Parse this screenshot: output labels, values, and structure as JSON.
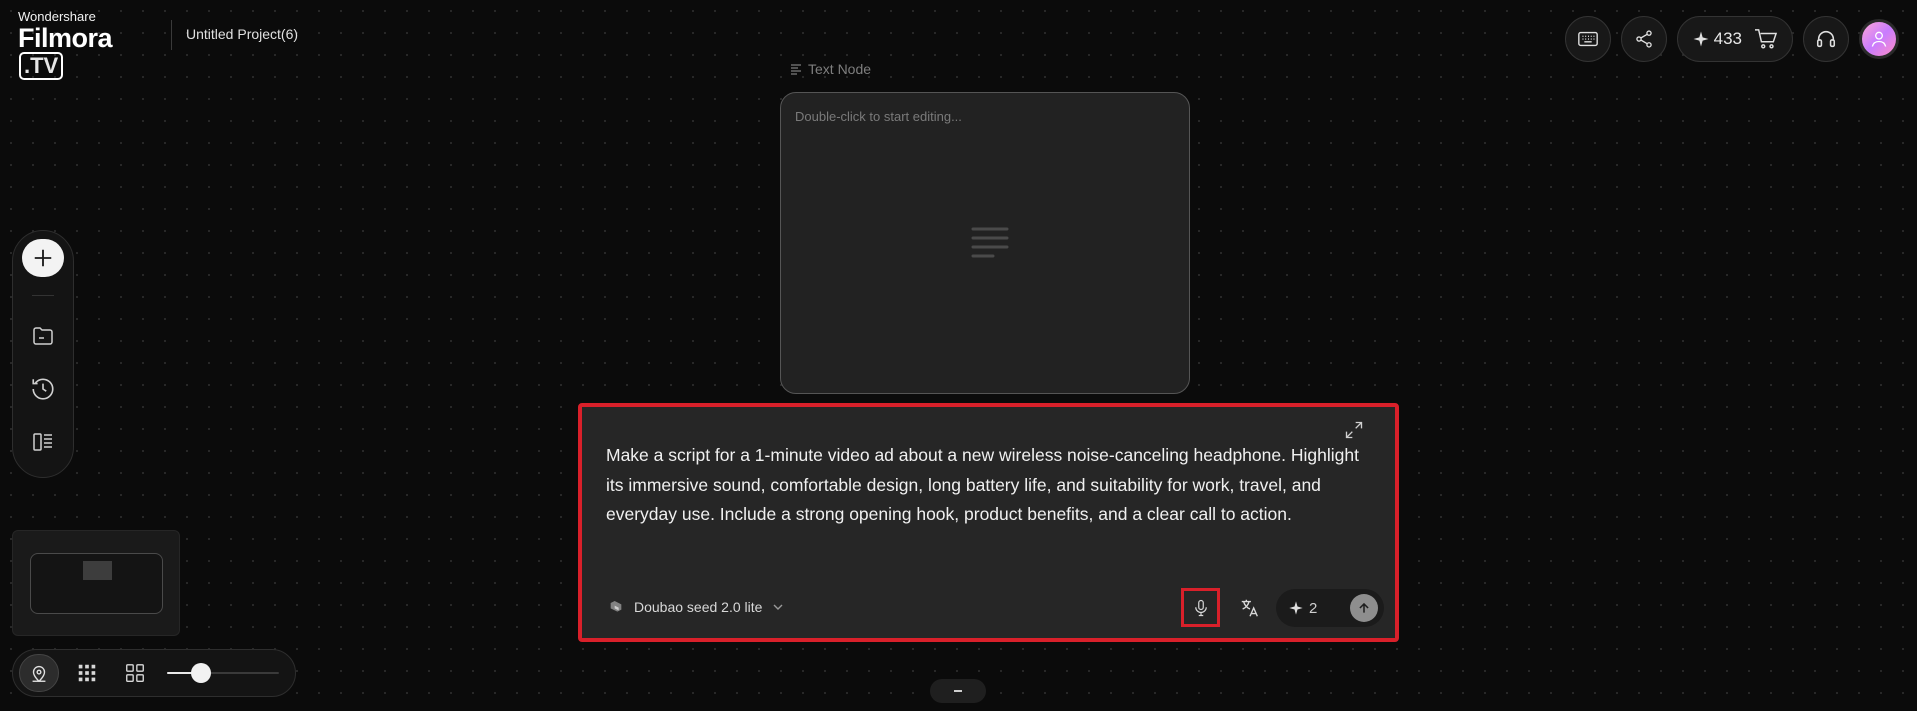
{
  "app": {
    "brand_small": "Wondershare",
    "brand_name": "Filmora",
    "brand_suffix": ".TV",
    "project_title": "Untitled Project(6)"
  },
  "header": {
    "credits": "433",
    "buttons": [
      "keyboard-icon",
      "share-icon",
      "sparkle-icon",
      "cart-icon",
      "headset-icon",
      "avatar"
    ]
  },
  "left_toolbar": {
    "items": [
      "plus-icon",
      "folder-icon",
      "history-icon",
      "layout-icon"
    ]
  },
  "bottom_controls": {
    "items": [
      "locate-icon",
      "grid-icon",
      "apps-icon"
    ],
    "zoom_level": 0.3
  },
  "text_node": {
    "label": "Text Node",
    "placeholder": "Double-click to start editing..."
  },
  "prompt": {
    "text": "Make a script for a 1-minute video ad about a new wireless noise-canceling headphone. Highlight its immersive sound, comfortable design, long battery life, and suitability for work, travel, and everyday use. Include a strong opening hook, product benefits, and a clear call to action.",
    "model": "Doubao seed 2.0 lite",
    "cost": "2"
  },
  "colors": {
    "highlight": "#d9202a",
    "panel": "#262626",
    "background": "#0b0b0b"
  }
}
